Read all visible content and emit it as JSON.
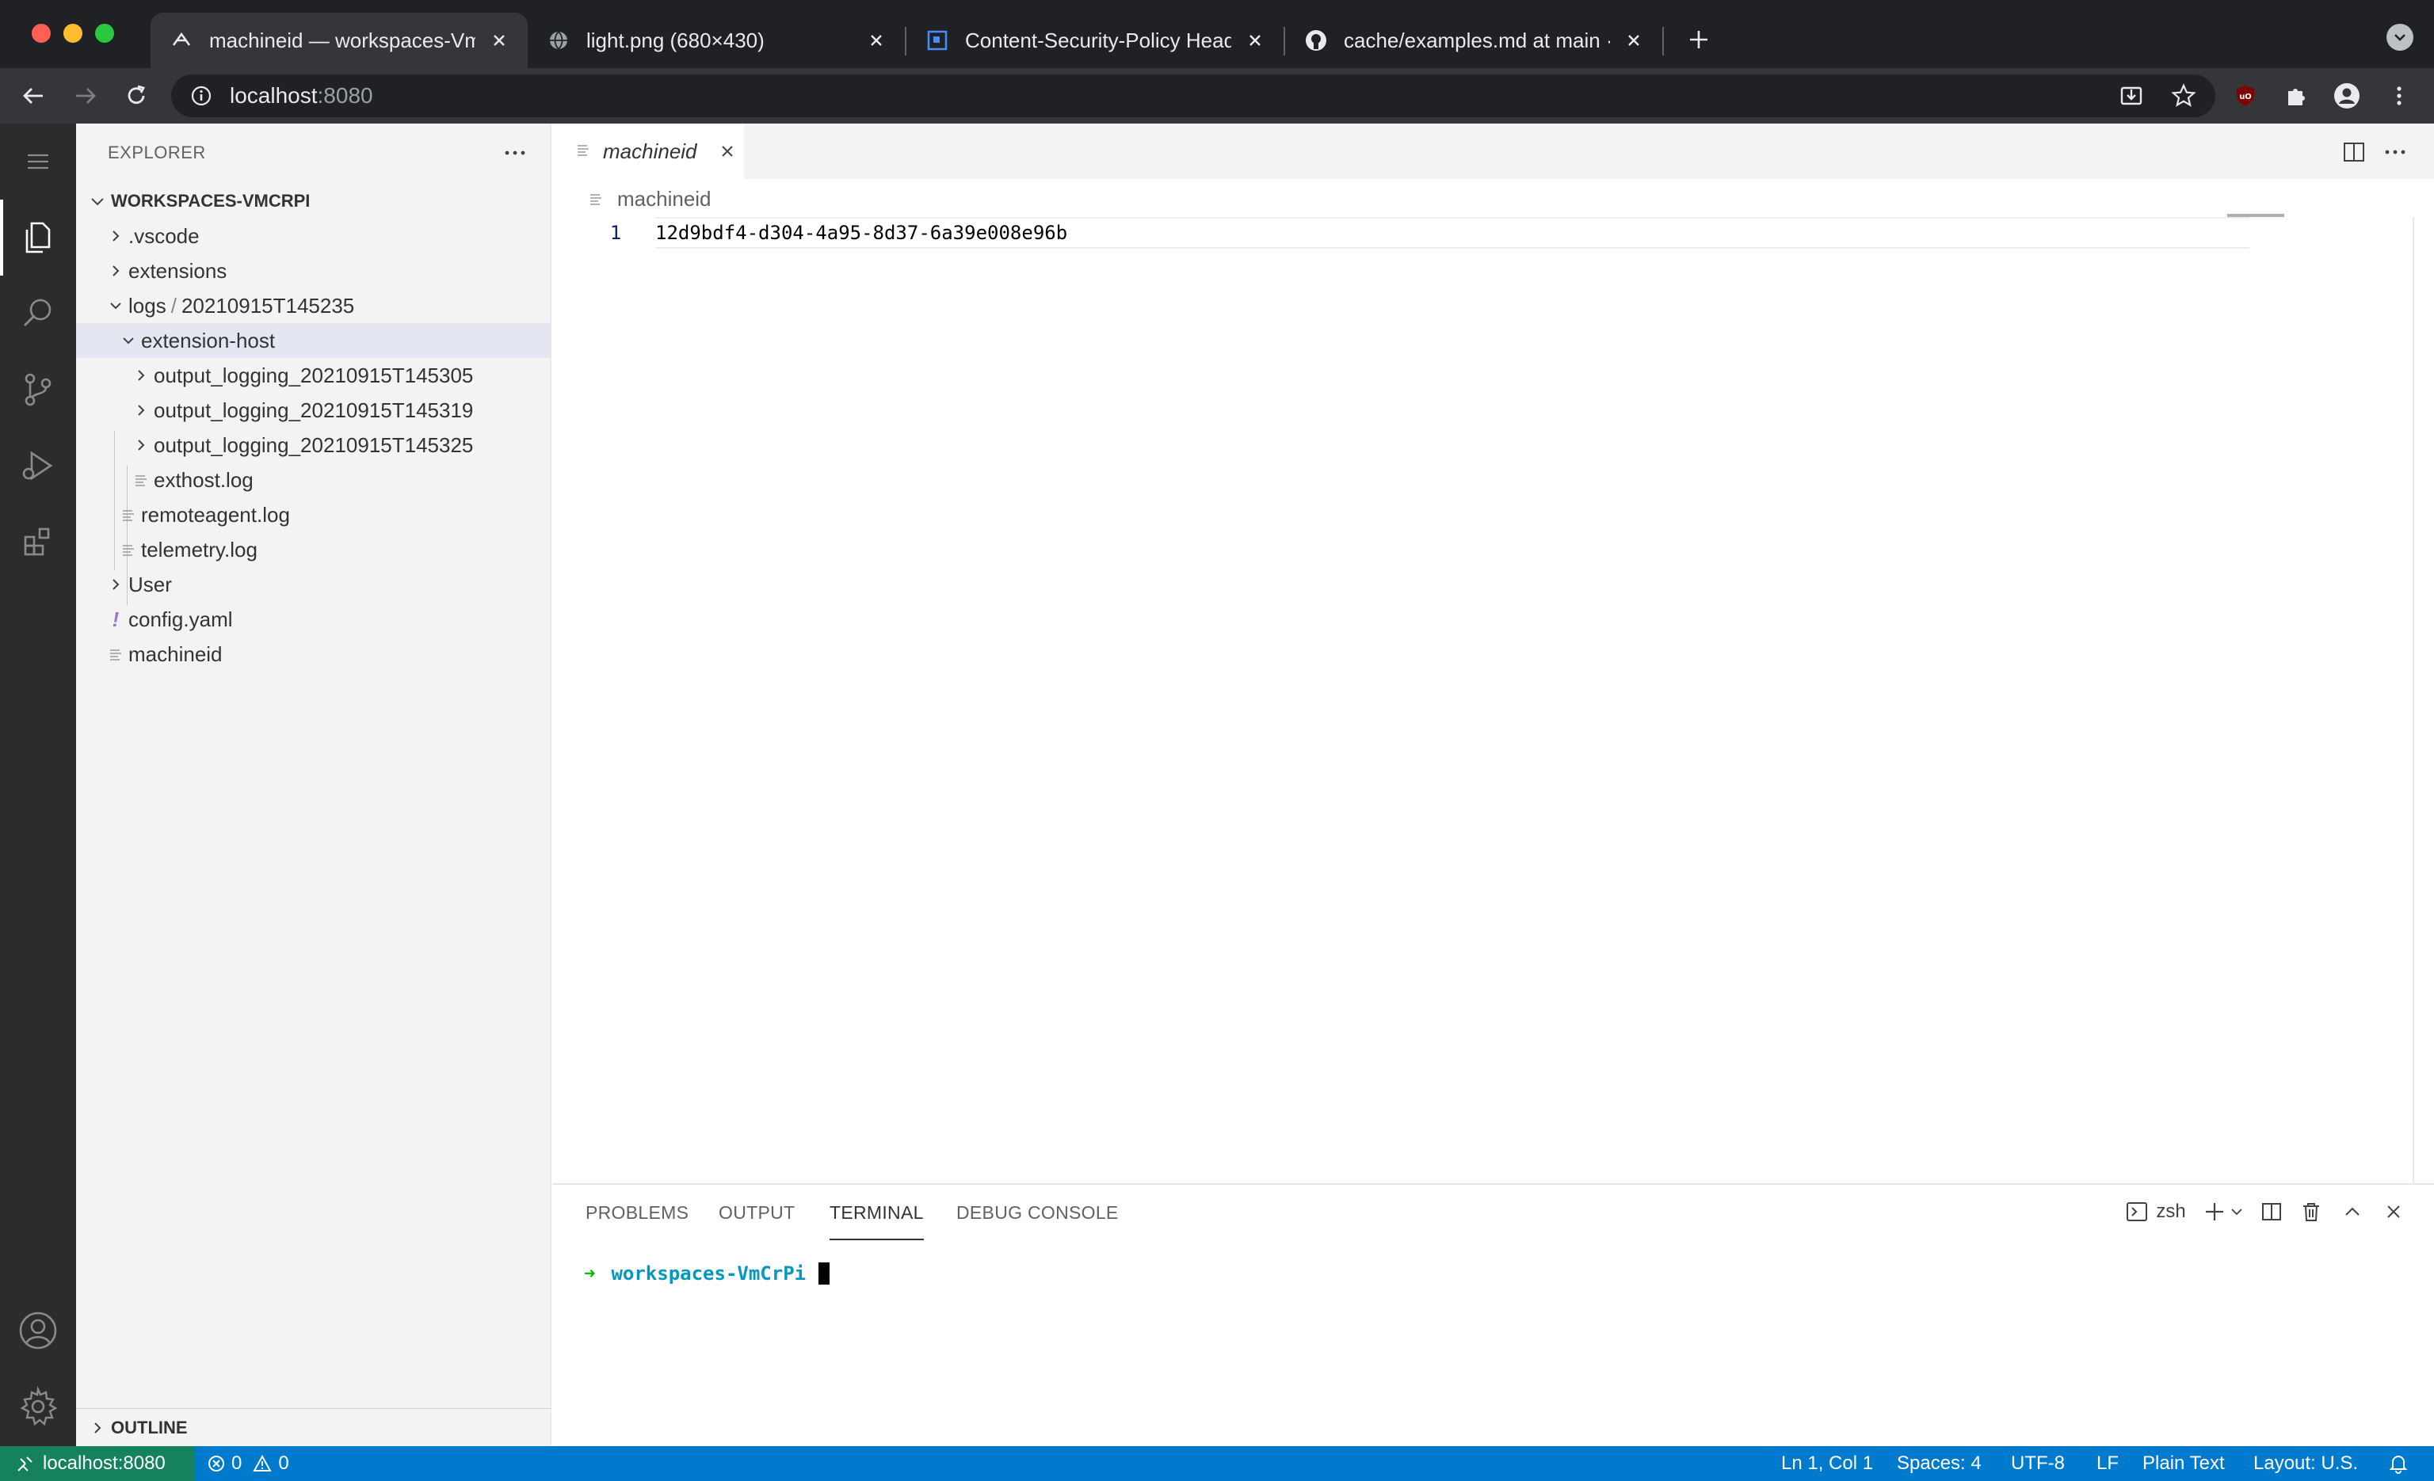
{
  "browser": {
    "tabs": [
      {
        "title": "machineid — workspaces-VmC",
        "active": true,
        "favicon": "vscode-remote-icon"
      },
      {
        "title": "light.png (680×430)",
        "active": false,
        "favicon": "globe-icon"
      },
      {
        "title": "Content-Security-Policy Heade",
        "active": false,
        "favicon": "csp-icon"
      },
      {
        "title": "cache/examples.md at main · a",
        "active": false,
        "favicon": "github-icon"
      }
    ],
    "address": {
      "host": "localhost",
      "port": ":8080"
    }
  },
  "explorer": {
    "header": "EXPLORER",
    "workspace": "WORKSPACES-VMCRPI",
    "items": [
      {
        "label": ".vscode"
      },
      {
        "label": "extensions"
      },
      {
        "label": "logs",
        "compact": "20210915T145235"
      },
      {
        "label": "extension-host"
      },
      {
        "label": "output_logging_20210915T145305"
      },
      {
        "label": "output_logging_20210915T145319"
      },
      {
        "label": "output_logging_20210915T145325"
      },
      {
        "label": "exthost.log"
      },
      {
        "label": "remoteagent.log"
      },
      {
        "label": "telemetry.log"
      },
      {
        "label": "User"
      },
      {
        "label": "config.yaml"
      },
      {
        "label": "machineid"
      }
    ],
    "outline": "OUTLINE"
  },
  "editor": {
    "tab_label": "machineid",
    "breadcrumb": "machineid",
    "line_number": "1",
    "content": "12d9bdf4-d304-4a95-8d37-6a39e008e96b"
  },
  "panel": {
    "tabs": [
      "PROBLEMS",
      "OUTPUT",
      "TERMINAL",
      "DEBUG CONSOLE"
    ],
    "active_tab": "TERMINAL",
    "shell": "zsh",
    "prompt_arrow": "➜",
    "prompt_dir": "workspaces-VmCrPi"
  },
  "status": {
    "remote": "localhost:8080",
    "errors": "0",
    "warnings": "0",
    "position": "Ln 1, Col 1",
    "spaces": "Spaces: 4",
    "encoding": "UTF-8",
    "eol": "LF",
    "language": "Plain Text",
    "layout": "Layout: U.S."
  },
  "colors": {
    "statusbar": "#007acc",
    "remote": "#16825d",
    "activitybar": "#2c2c2c",
    "terminal_arrow": "#00bc00",
    "terminal_dir": "#0598bc"
  }
}
